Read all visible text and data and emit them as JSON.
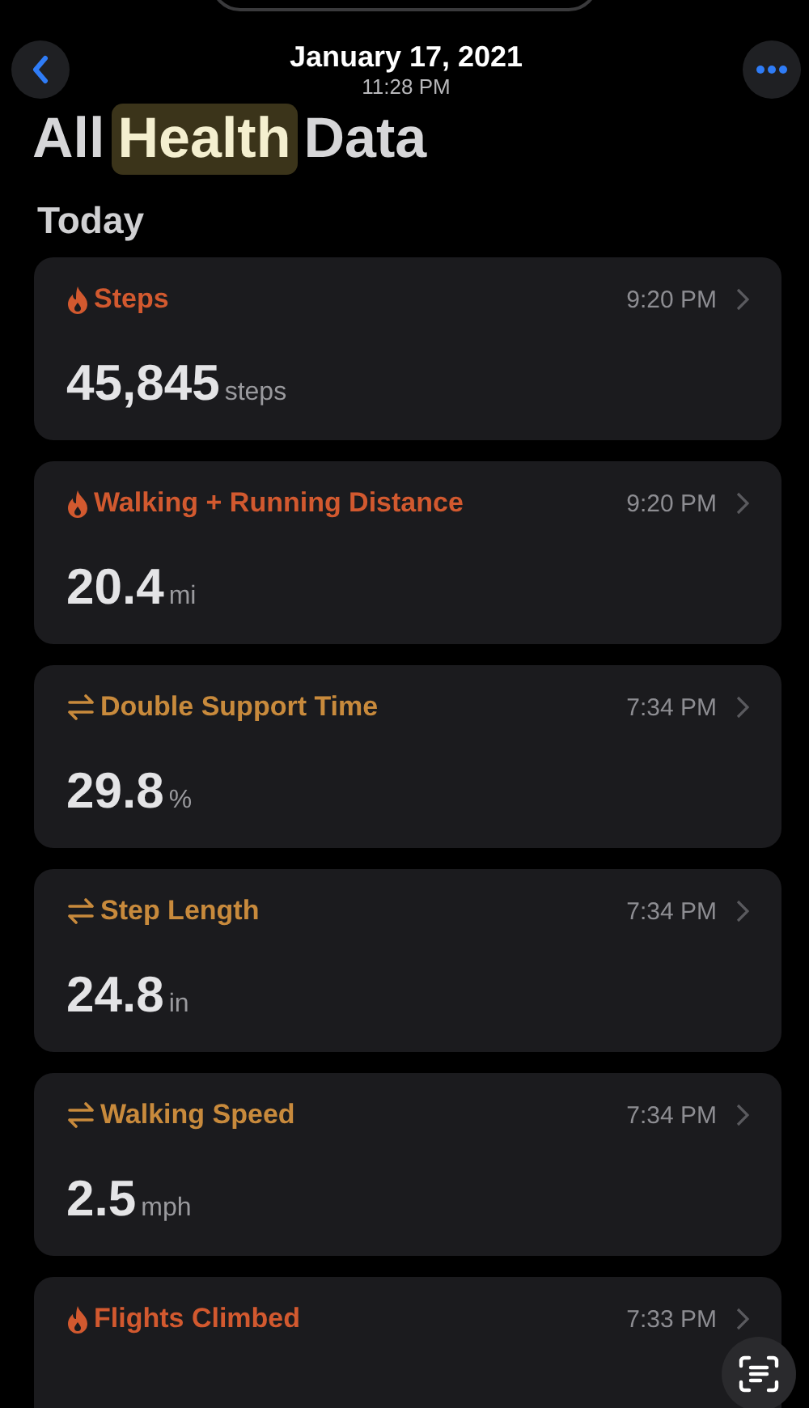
{
  "header": {
    "date": "January 17, 2021",
    "time": "11:28 PM"
  },
  "title_parts": [
    {
      "text": "All",
      "highlighted": false
    },
    {
      "text": "Health",
      "highlighted": true
    },
    {
      "text": "Data",
      "highlighted": false
    }
  ],
  "section": "Today",
  "cards": [
    {
      "kind": "activity",
      "color": "#d2592f",
      "name": "Steps",
      "time": "9:20 PM",
      "value": "45,845",
      "unit": "steps"
    },
    {
      "kind": "activity",
      "color": "#d2592f",
      "name": "Walking + Running Distance",
      "time": "9:20 PM",
      "value": "20.4",
      "unit": "mi"
    },
    {
      "kind": "mobility",
      "color": "#c88a3c",
      "name": "Double Support Time",
      "time": "7:34 PM",
      "value": "29.8",
      "unit": "%"
    },
    {
      "kind": "mobility",
      "color": "#c88a3c",
      "name": "Step Length",
      "time": "7:34 PM",
      "value": "24.8",
      "unit": "in"
    },
    {
      "kind": "mobility",
      "color": "#c88a3c",
      "name": "Walking Speed",
      "time": "7:34 PM",
      "value": "2.5",
      "unit": "mph"
    },
    {
      "kind": "activity",
      "color": "#d2592f",
      "name": "Flights Climbed",
      "time": "7:33 PM"
    }
  ]
}
